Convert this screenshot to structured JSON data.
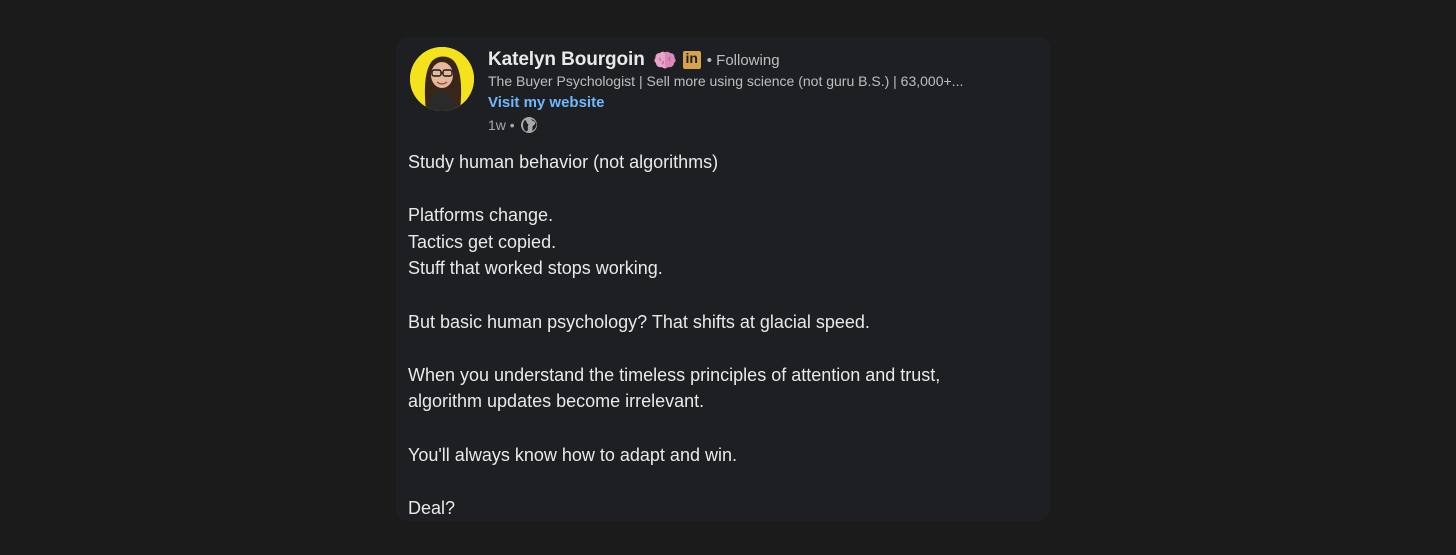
{
  "post": {
    "author": {
      "name": "Katelyn Bourgoin",
      "follow_status": "• Following",
      "headline": "The Buyer Psychologist | Sell more using science (not guru B.S.) | 63,000+...",
      "website_link": "Visit my website",
      "timestamp": "1w •",
      "badges": [
        "brain-emoji",
        "linkedin-premium-icon"
      ],
      "linkedin_badge_text": "in"
    },
    "visibility_icon": "globe-icon",
    "body_lines": [
      "Study human behavior (not algorithms)",
      "",
      "Platforms change.",
      "Tactics get copied.",
      "Stuff that worked stops working.",
      "",
      "But basic human psychology? That shifts at glacial speed.",
      "",
      "When you understand the timeless principles of attention and trust,",
      "algorithm updates become irrelevant.",
      "",
      "You'll always know how to adapt and win.",
      "",
      "Deal?"
    ]
  },
  "colors": {
    "page_background": "#1b1b1b",
    "card_background": "#1d1f23",
    "link": "#71b7fb",
    "avatar_background": "#f3e21c",
    "premium_badge": "#d6a24a"
  }
}
